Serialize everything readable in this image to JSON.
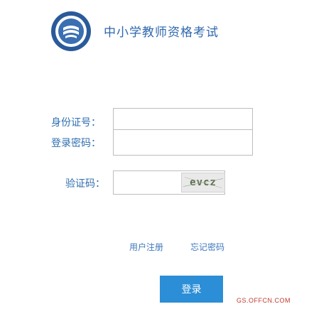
{
  "header": {
    "title": "中小学教师资格考试",
    "logo_icon": "exam-emblem-icon"
  },
  "form": {
    "id_label": "身份证号：",
    "id_value": "",
    "password_label": "登录密码：",
    "password_value": "",
    "captcha_label": "验证码：",
    "captcha_value": "",
    "captcha_text": "evcz"
  },
  "links": {
    "register": "用户注册",
    "forgot": "忘记密码"
  },
  "actions": {
    "login_label": "登录"
  },
  "watermark": "GS.OFFCN.COM",
  "colors": {
    "accent": "#2e67ad",
    "button": "#2b8ed6",
    "watermark": "#c0392b"
  }
}
